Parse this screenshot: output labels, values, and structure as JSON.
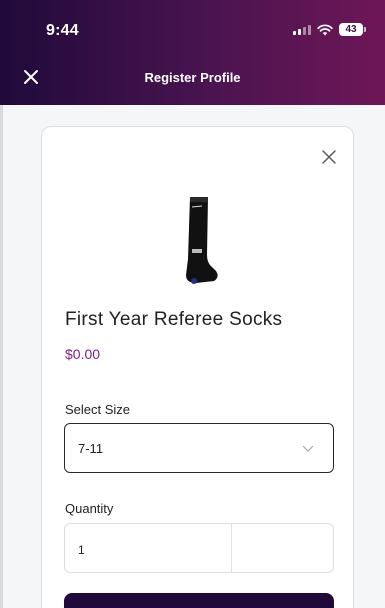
{
  "status_bar": {
    "time": "9:44",
    "battery": "43"
  },
  "nav": {
    "title": "Register Profile",
    "close_icon": "close-icon"
  },
  "modal": {
    "close_icon": "close-icon",
    "product": {
      "image": "referee-sock-image",
      "name": "First Year Referee Socks",
      "price": "$0.00"
    },
    "size": {
      "label": "Select Size",
      "selected": "7-11",
      "icon": "chevron-down-icon"
    },
    "quantity": {
      "label": "Quantity",
      "value": "1"
    }
  },
  "colors": {
    "header_start": "#1f0a3a",
    "header_end": "#6e1656",
    "price": "#7a1f7a",
    "primary_button": "#1f0a3a"
  }
}
